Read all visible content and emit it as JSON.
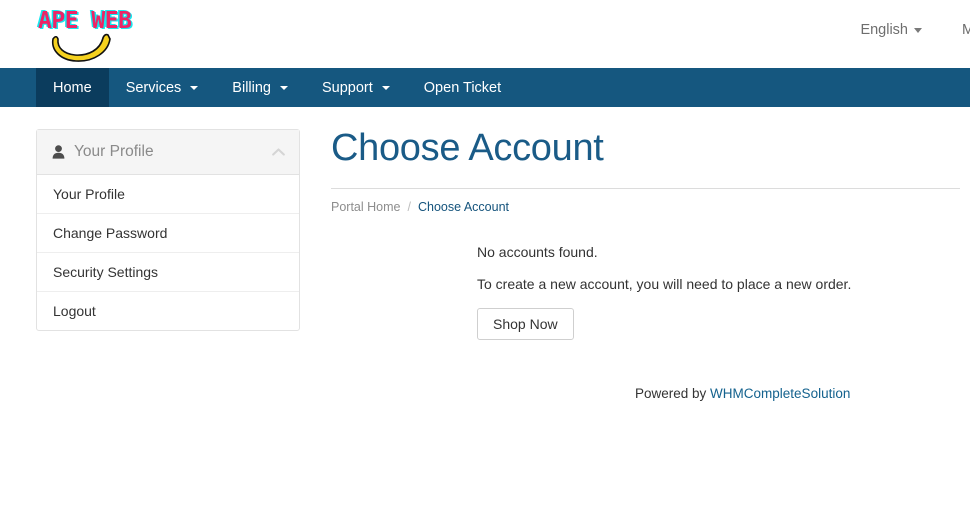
{
  "header": {
    "logo_text": "APE WEB",
    "logo_icon": "banana-icon",
    "language": "English",
    "language_caret": "chevron-down-icon",
    "clipped_right_text": "My Account"
  },
  "navbar": {
    "items": [
      {
        "label": "Home",
        "active": true,
        "has_caret": false
      },
      {
        "label": "Services",
        "active": false,
        "has_caret": true
      },
      {
        "label": "Billing",
        "active": false,
        "has_caret": true
      },
      {
        "label": "Support",
        "active": false,
        "has_caret": true
      },
      {
        "label": "Open Ticket",
        "active": false,
        "has_caret": false
      }
    ]
  },
  "sidebar": {
    "panel_title": "Your Profile",
    "panel_icon": "user-icon",
    "collapse_icon": "chevron-up-icon",
    "items": [
      {
        "label": "Your Profile"
      },
      {
        "label": "Change Password"
      },
      {
        "label": "Security Settings"
      },
      {
        "label": "Logout"
      }
    ]
  },
  "main": {
    "title": "Choose Account",
    "breadcrumb": {
      "home": "Portal Home",
      "separator": "/",
      "current": "Choose Account"
    },
    "message_primary": "No accounts found.",
    "message_secondary": "To create a new account, you will need to place a new order.",
    "shop_button": "Shop Now"
  },
  "footer": {
    "powered_by": "Powered by ",
    "product": "WHMCompleteSolution"
  },
  "colors": {
    "navbar": "#15577f",
    "navbar_active": "#0b3c5d",
    "title": "#1a5b87",
    "link": "#14628e",
    "logo_pink": "#ee2466",
    "logo_cyan": "#16e8ef",
    "banana_yellow": "#f5d11e"
  }
}
